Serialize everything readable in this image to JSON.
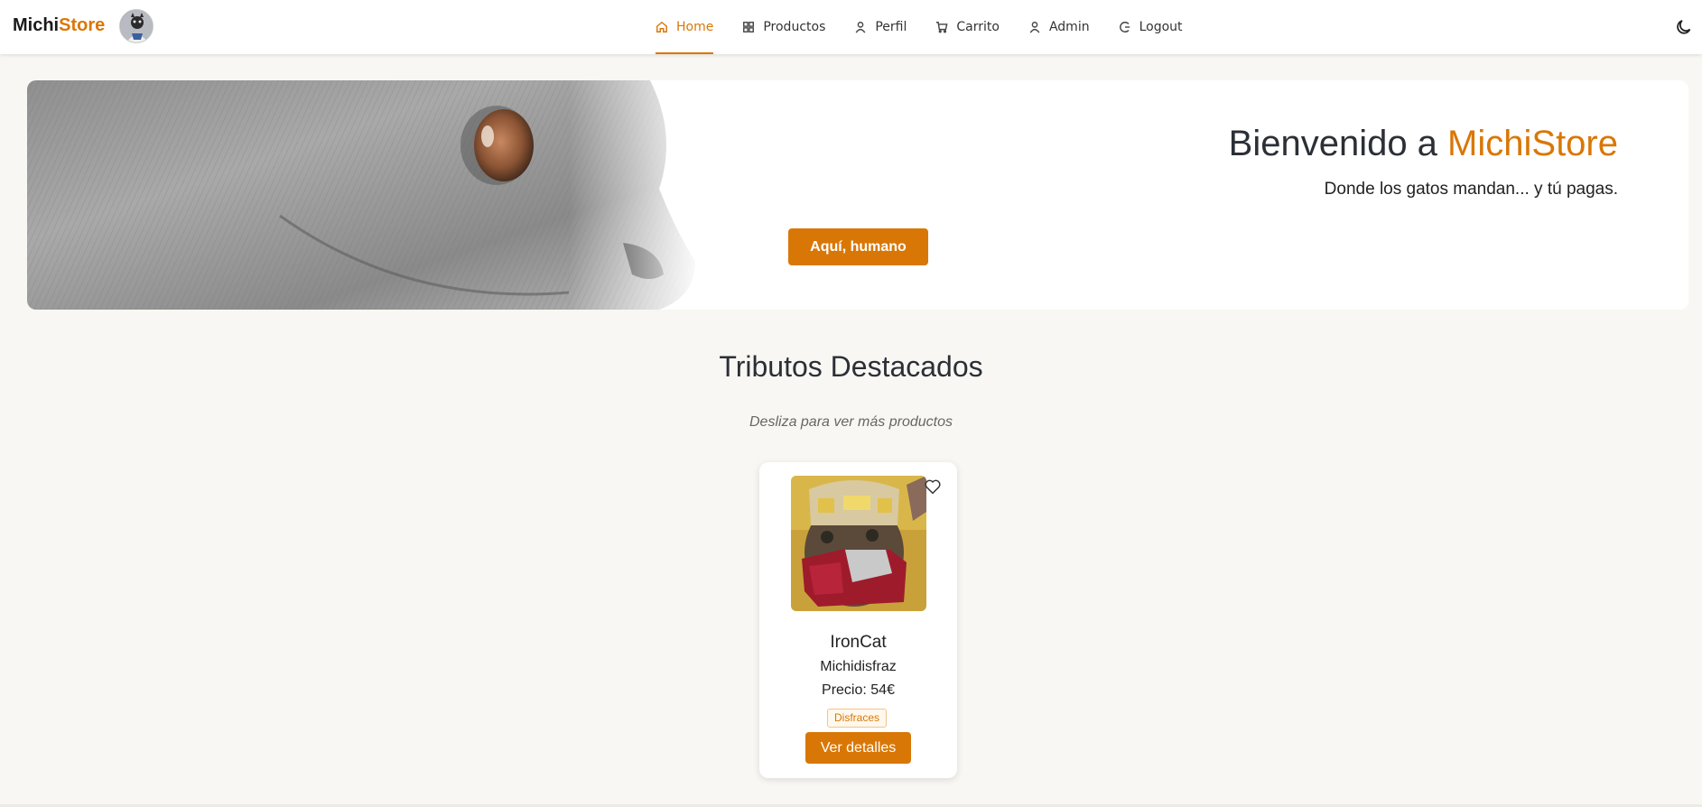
{
  "brand": {
    "part1": "Michi",
    "part2": "Store"
  },
  "nav": {
    "items": [
      {
        "label": "Home",
        "icon": "home-icon",
        "active": true
      },
      {
        "label": "Productos",
        "icon": "grid-icon",
        "active": false
      },
      {
        "label": "Perfil",
        "icon": "user-icon",
        "active": false
      },
      {
        "label": "Carrito",
        "icon": "cart-icon",
        "active": false
      },
      {
        "label": "Admin",
        "icon": "user-icon",
        "active": false
      },
      {
        "label": "Logout",
        "icon": "logout-icon",
        "active": false
      }
    ],
    "theme_icon": "moon-icon"
  },
  "hero": {
    "title_prefix": "Bienvenido a ",
    "title_accent": "MichiStore",
    "subtitle": "Donde los gatos mandan... y tú pagas.",
    "button_label": "Aquí, humano"
  },
  "featured": {
    "title": "Tributos Destacados",
    "hint": "Desliza para ver más productos",
    "products": [
      {
        "name": "IronCat",
        "subtitle": "Michidisfraz",
        "price": "Precio: 54€",
        "tag": "Disfraces",
        "button_label": "Ver detalles"
      }
    ]
  },
  "colors": {
    "accent": "#d97706",
    "background": "#f9f7f3"
  }
}
